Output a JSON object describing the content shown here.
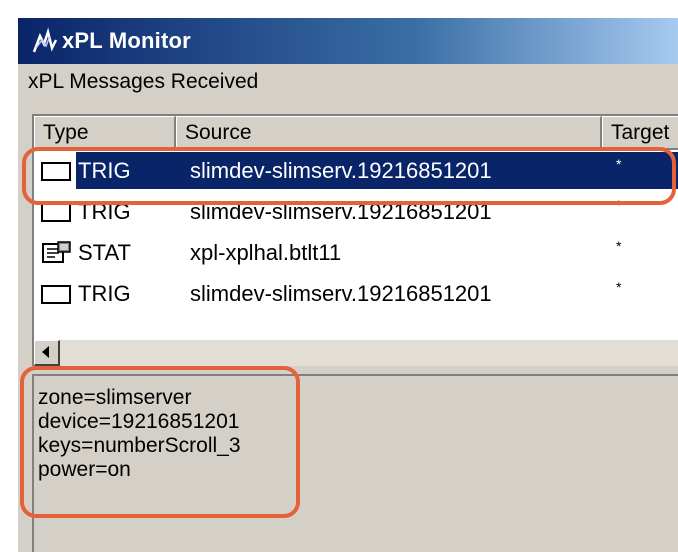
{
  "window": {
    "title": "xPL Monitor",
    "icon": "xpl-app-icon"
  },
  "messages_label": "xPL Messages Received",
  "columns": [
    "Type",
    "Source",
    "Target"
  ],
  "rows": [
    {
      "type": "TRIG",
      "source": "slimdev-slimserv.19216851201",
      "target": "*",
      "icon": "message-icon",
      "selected": true
    },
    {
      "type": "TRIG",
      "source": "slimdev-slimserv.19216851201",
      "target": "*",
      "icon": "message-icon",
      "selected": false
    },
    {
      "type": "STAT",
      "source": "xpl-xplhal.btlt11",
      "target": "*",
      "icon": "status-icon",
      "selected": false
    },
    {
      "type": "TRIG",
      "source": "slimdev-slimserv.19216851201",
      "target": "*",
      "icon": "message-icon",
      "selected": false
    }
  ],
  "detail_lines": [
    "zone=slimserver",
    "device=19216851201",
    "keys=numberScroll_3",
    "power=on"
  ],
  "colors": {
    "title_gradient_start": "#0a246a",
    "selection": "#0a246a",
    "annotation": "#e4623a",
    "face": "#d4d0c8"
  }
}
